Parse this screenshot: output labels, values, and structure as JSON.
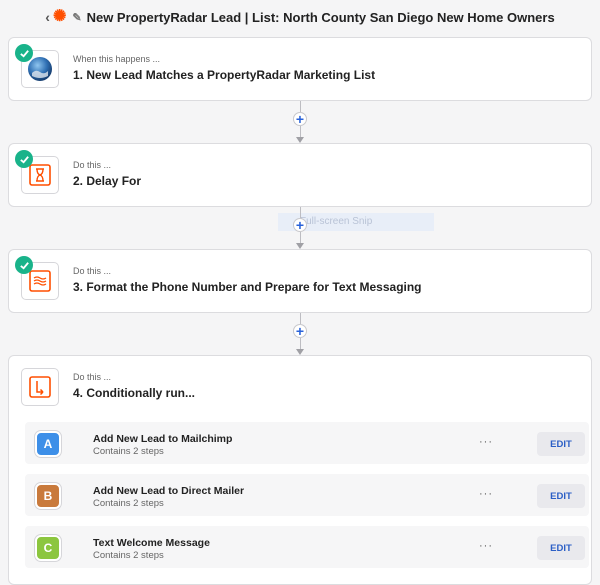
{
  "header": {
    "back_glyph": "‹",
    "title": "New PropertyRadar Lead | List: North County San Diego New Home Owners"
  },
  "steps": [
    {
      "sub": "When this happens ...",
      "title": "1. New Lead Matches a PropertyRadar Marketing List",
      "icon": "globe-icon"
    },
    {
      "sub": "Do this ...",
      "title": "2. Delay For",
      "icon": "hourglass-icon"
    },
    {
      "sub": "Do this ...",
      "title": "3. Format the Phone Number and Prepare for Text Messaging",
      "icon": "formatter-icon"
    },
    {
      "sub": "Do this ...",
      "title": "4. Conditionally run...",
      "icon": "branch-icon"
    }
  ],
  "ghost_text": "Full-screen Snip",
  "paths": [
    {
      "letter": "A",
      "color": "#3d8fe8",
      "title": "Add New Lead to Mailchimp",
      "sub": "Contains 2 steps",
      "menu": "···",
      "edit": "EDIT"
    },
    {
      "letter": "B",
      "color": "#c97a3c",
      "title": "Add New Lead to Direct Mailer",
      "sub": "Contains 2 steps",
      "menu": "···",
      "edit": "EDIT"
    },
    {
      "letter": "C",
      "color": "#8cc63f",
      "title": "Text Welcome Message",
      "sub": "Contains 2 steps",
      "menu": "···",
      "edit": "EDIT"
    }
  ],
  "colors": {
    "accent": "#ff4f00",
    "success": "#19b38a",
    "link": "#2962d9"
  }
}
